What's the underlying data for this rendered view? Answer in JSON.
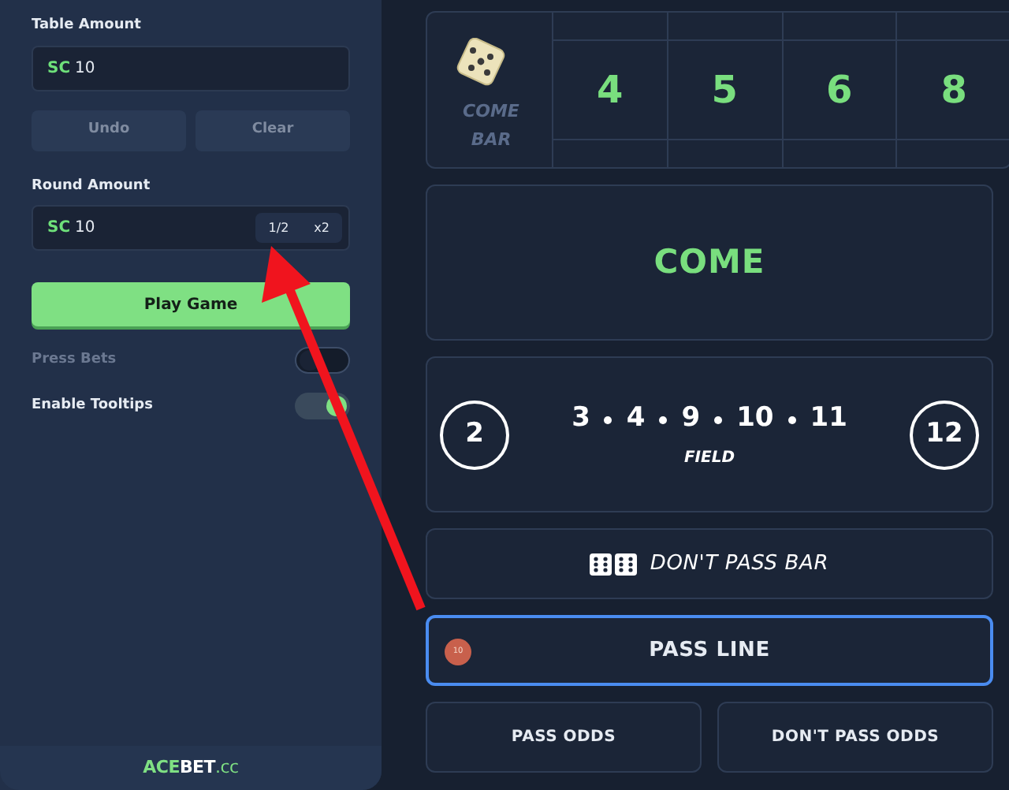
{
  "sidebar": {
    "table_amount": {
      "label": "Table Amount",
      "currency": "SC",
      "value": "10"
    },
    "actions": [
      {
        "label": "Undo"
      },
      {
        "label": "Clear"
      }
    ],
    "round_amount": {
      "label": "Round Amount",
      "currency": "SC",
      "value": "10",
      "modifiers": [
        "1/2",
        "x2"
      ]
    },
    "play_button": "Play Game",
    "toggles": [
      {
        "label": "Press Bets",
        "on": false,
        "disabled": true
      },
      {
        "label": "Enable Tooltips",
        "on": true,
        "disabled": false
      }
    ],
    "footer_logo": {
      "part_1": "ACE",
      "part_2": "BET",
      "part_3": ".cc"
    }
  },
  "table": {
    "dont_come_bar": [
      "COME",
      "BAR"
    ],
    "points": [
      "4",
      "5",
      "6",
      "8"
    ],
    "come": "COME",
    "field": {
      "numbers": [
        {
          "text": "2",
          "kind": "circle"
        },
        {
          "text": "3",
          "kind": "plain"
        },
        {
          "text": "4",
          "kind": "plain"
        },
        {
          "text": "9",
          "kind": "plain"
        },
        {
          "text": "10",
          "kind": "plain"
        },
        {
          "text": "11",
          "kind": "plain"
        },
        {
          "text": "12",
          "kind": "circle"
        }
      ],
      "label": "FIELD"
    },
    "dont_pass_bar": "DON'T PASS BAR",
    "pass_line": {
      "label": "PASS LINE",
      "selected": true,
      "chip": "10"
    },
    "odds": [
      {
        "label": "PASS ODDS",
        "selected": false
      },
      {
        "label": "DON'T PASS ODDS",
        "selected": false
      }
    ]
  }
}
